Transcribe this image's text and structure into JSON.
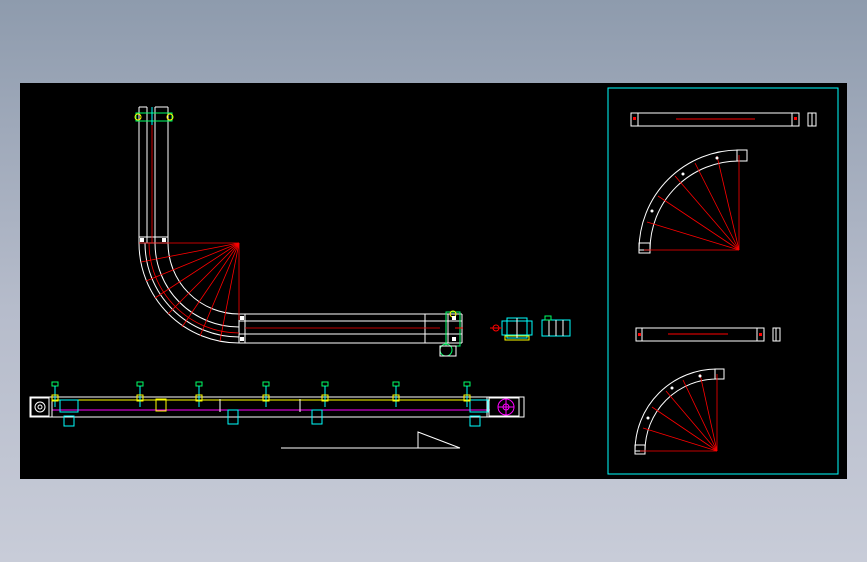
{
  "viewport": {
    "background": "#000000",
    "desktop_gradient": [
      "#8e9bad",
      "#c8ccd8"
    ]
  },
  "colors": {
    "outline": "#ffffff",
    "construction": "#ff0000",
    "frame": "#00ffff",
    "highlight": "#ff00ff",
    "fitting": "#00ff66",
    "accent": "#ffff00",
    "tan": "#c8a070"
  },
  "drawing": {
    "views": [
      "plan-view-l-conveyor",
      "elevation-view-straight-conveyor",
      "detail-drive-unit",
      "detail-sheet-frame",
      "detail-straight-rail-top",
      "detail-curve-top",
      "detail-straight-rail-bottom",
      "detail-curve-bottom"
    ],
    "leg_count": 7
  }
}
